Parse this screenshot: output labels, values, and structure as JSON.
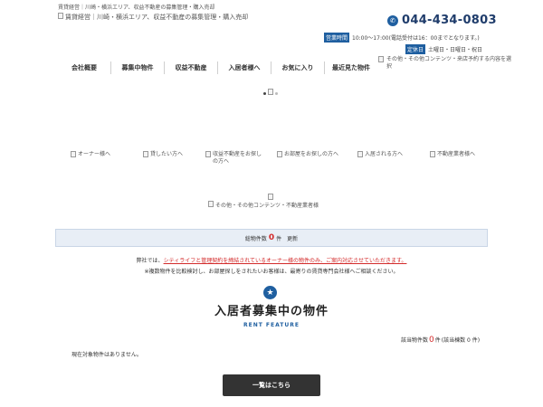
{
  "header": {
    "tagline": "賃貸経営｜川崎・横浜エリア、収益不動産の募集管理・購入売却",
    "logo_alt": "賃貸経営｜川崎・横浜エリア、収益不動産の募集管理・購入売却",
    "phone": "044-434-0803",
    "hours_label": "営業時間",
    "hours_text": "10:00～17:00(電話受付は16：00までとなります。)",
    "holiday_label": "定休日",
    "holiday_text": "土曜日・日曜日・祝日"
  },
  "nav": {
    "items": [
      "会社概要",
      "募集中物件",
      "収益不動産",
      "入居者様へ",
      "お気に入り",
      "最近見た物件"
    ],
    "extra": "その他・その他コンテンツ・来店予約する内容を選択"
  },
  "banners": [
    "オーナー様へ",
    "貸したい方へ",
    "収益不動産をお探しの方へ",
    "お部屋をお探しの方へ",
    "入居される方へ",
    "不動産業者様へ"
  ],
  "banner_other": "その他・その他コンテンツ・不動産業者様",
  "count_bar": {
    "label": "総物件数",
    "count": "0",
    "unit": "件",
    "suffix": "更新"
  },
  "notice": {
    "prefix": "弊社では、",
    "highlight": "シティライフと管理契約を締結されているオーナー様の物件のみ、ご案内対応させていただきます。",
    "line2": "※複数物件を比較検討し、お部屋探しをされたいお客様は、最寄りの賃貸専門会社様へご相談ください。"
  },
  "section": {
    "title": "入居者募集中の物件",
    "subtitle": "RENT FEATURE",
    "match_label": "該当物件数",
    "match_count": "0",
    "match_unit": "件",
    "match_detail": "(該当棟数 0 件)",
    "empty_text": "現在対象物件はありません。",
    "list_button": "一覧はこちら"
  },
  "icons": {
    "phone": "phone-icon",
    "star": "star-icon",
    "broken_image": "broken-image-icon"
  },
  "colors": {
    "brand_blue": "#1f5fa0",
    "accent_red": "#d32a2a",
    "button_dark": "#333333"
  }
}
